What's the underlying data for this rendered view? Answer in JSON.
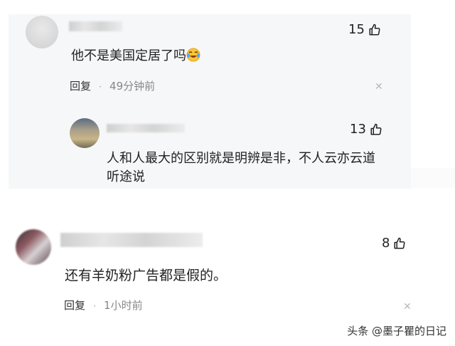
{
  "comment1": {
    "text": "他不是美国定居了吗",
    "emoji": "laughing-crying-emoji",
    "likes": "15",
    "reply_label": "回复",
    "separator": "·",
    "time": "49分钟前"
  },
  "reply1": {
    "text_line1": "人和人最大的区别就是明辨是非，不人云亦云道",
    "text_line2": "听途说",
    "likes": "13"
  },
  "comment2": {
    "text": "还有羊奶粉广告都是假的。",
    "likes": "8",
    "reply_label": "回复",
    "separator": "·",
    "time": "1小时前"
  },
  "watermark": "头条 @墨子瞿的日记",
  "colors": {
    "card_bg": "#f6f7f8",
    "muted": "#888888"
  }
}
